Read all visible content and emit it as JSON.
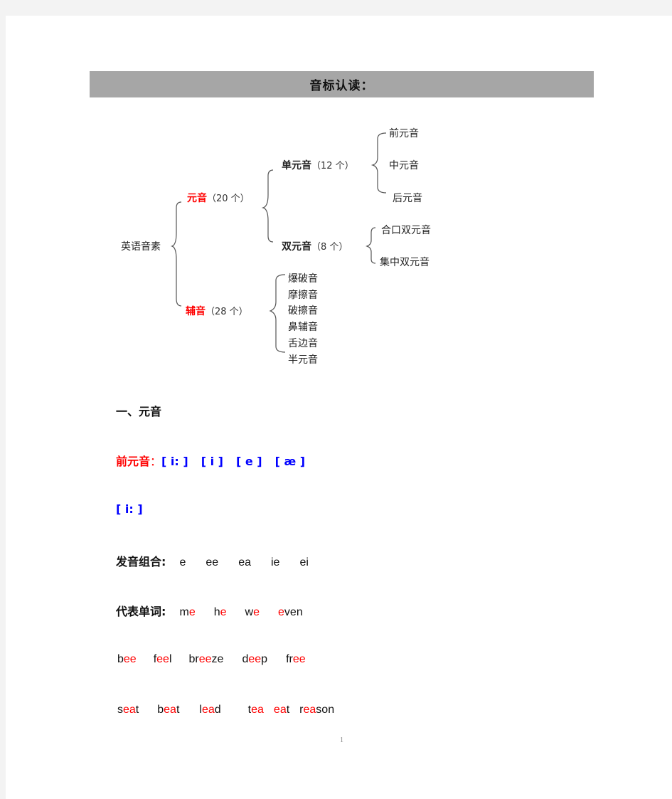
{
  "title": "音标认读：",
  "tree": {
    "root": "英语音素",
    "vowel": {
      "label": "元音",
      "count": "（20 个）"
    },
    "monophthong": {
      "label": "单元音",
      "count": "（12 个）",
      "children": [
        "前元音",
        "中元音",
        "后元音"
      ]
    },
    "diphthong": {
      "label": "双元音",
      "count": "（8 个）",
      "children": [
        "合口双元音",
        "集中双元音"
      ]
    },
    "consonant": {
      "label": "辅音",
      "count": "（28 个）",
      "children": [
        "爆破音",
        "摩擦音",
        "破擦音",
        "鼻辅音",
        "舌边音",
        "半元音"
      ]
    }
  },
  "section1": {
    "heading": "一、元音",
    "front_vowels_label": "前元音",
    "colon": "：",
    "front_vowels": [
      "[ i: ]",
      "[ i ]",
      "[ e ]",
      "[ æ ]"
    ],
    "current_symbol": "[ i: ]",
    "combos_label": "发音组合:",
    "combos": [
      "e",
      "ee",
      "ea",
      "ie",
      "ei"
    ],
    "words_label": "代表单词:",
    "words_row1": [
      {
        "pre": "m",
        "hl": "e",
        "post": ""
      },
      {
        "pre": "h",
        "hl": "e",
        "post": ""
      },
      {
        "pre": "w",
        "hl": "e",
        "post": ""
      },
      {
        "pre": "",
        "hl": "e",
        "post": "ven"
      }
    ],
    "words_row2": [
      {
        "pre": "b",
        "hl": "ee",
        "post": ""
      },
      {
        "pre": "f",
        "hl": "ee",
        "post": "l"
      },
      {
        "pre": "br",
        "hl": "ee",
        "post": "ze"
      },
      {
        "pre": "d",
        "hl": "ee",
        "post": "p"
      },
      {
        "pre": "fr",
        "hl": "ee",
        "post": ""
      }
    ],
    "words_row3": [
      {
        "pre": "s",
        "hl": "ea",
        "post": "t"
      },
      {
        "pre": "b",
        "hl": "ea",
        "post": "t"
      },
      {
        "pre": "l",
        "hl": "ea",
        "post": "d"
      },
      {
        "pre": "t",
        "hl": "ea",
        "post": ""
      },
      {
        "pre": "",
        "hl": "ea",
        "post": "t"
      },
      {
        "pre": "r",
        "hl": "ea",
        "post": "son"
      }
    ]
  },
  "page_number": "1",
  "colors": {
    "highlight": "#ff0000",
    "phonetic": "#0000ff",
    "title_bar": "#a6a6a6"
  }
}
